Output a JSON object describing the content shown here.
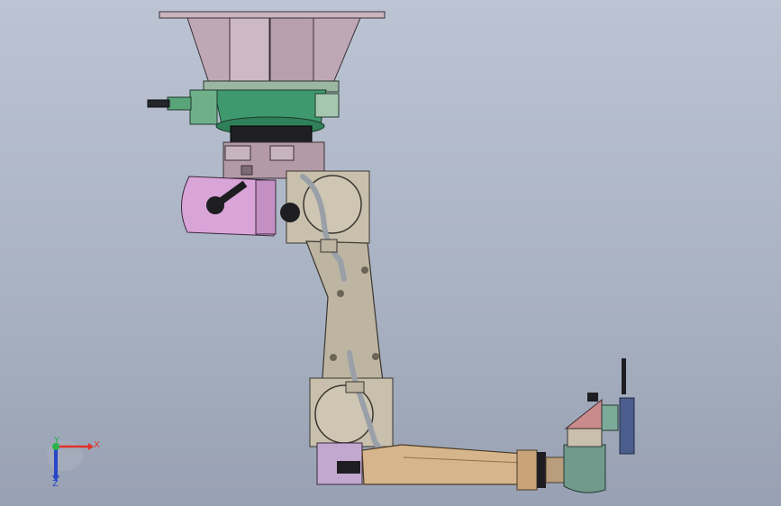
{
  "viewport": {
    "background_top": "#bcc4d4",
    "background_bottom": "#98a1b3"
  },
  "colors": {
    "mount_plate": "#bfa8b6",
    "motor_green": "#3e9a6e",
    "pink_motor": "#d9a4d8",
    "arm_tan": "#bdb5a2",
    "forearm_tan": "#d6b58c",
    "cable": "#9aa0a8",
    "dark": "#1e1e22"
  },
  "triad": {
    "x_label": "X",
    "y_label": "Y",
    "z_label": "Z",
    "x_color": "#e0322a",
    "y_color": "#2bb24c",
    "z_color": "#2a46c8"
  }
}
